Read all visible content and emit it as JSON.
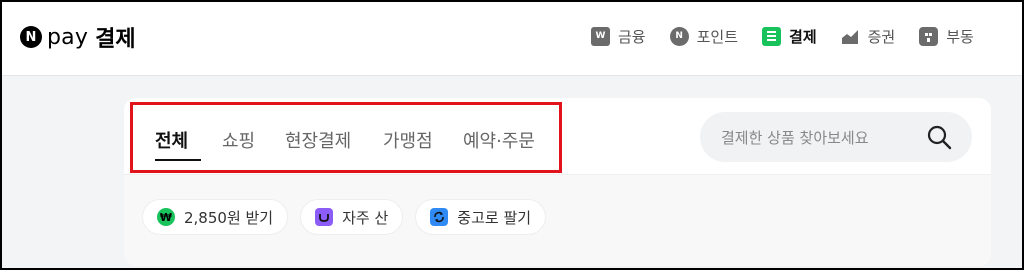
{
  "header": {
    "logo_mark": "N",
    "logo_text": "pay",
    "title": "결제",
    "nav": [
      {
        "label": "금융",
        "icon": "wallet-icon",
        "icon_text": "W"
      },
      {
        "label": "포인트",
        "icon": "point-icon",
        "icon_text": "N"
      },
      {
        "label": "결제",
        "icon": "receipt-icon",
        "active": true
      },
      {
        "label": "증권",
        "icon": "stock-chart-icon"
      },
      {
        "label": "부동",
        "icon": "building-icon"
      }
    ]
  },
  "tabs": [
    "전체",
    "쇼핑",
    "현장결제",
    "가맹점",
    "예약·주문"
  ],
  "active_tab": "전체",
  "search": {
    "placeholder": "결제한 상품 찾아보세요"
  },
  "chips": [
    {
      "label": "2,850원 받기",
      "icon": "naver-pay-coin-icon",
      "icon_text": "₩"
    },
    {
      "label": "자주 산",
      "icon": "shopping-bag-icon"
    },
    {
      "label": "중고로 팔기",
      "icon": "recycle-icon"
    }
  ],
  "colors": {
    "accent_green": "#19c35b",
    "highlight_box": "#e0141a",
    "bag_purple": "#8b5cf6",
    "swap_blue": "#2f8af5"
  }
}
